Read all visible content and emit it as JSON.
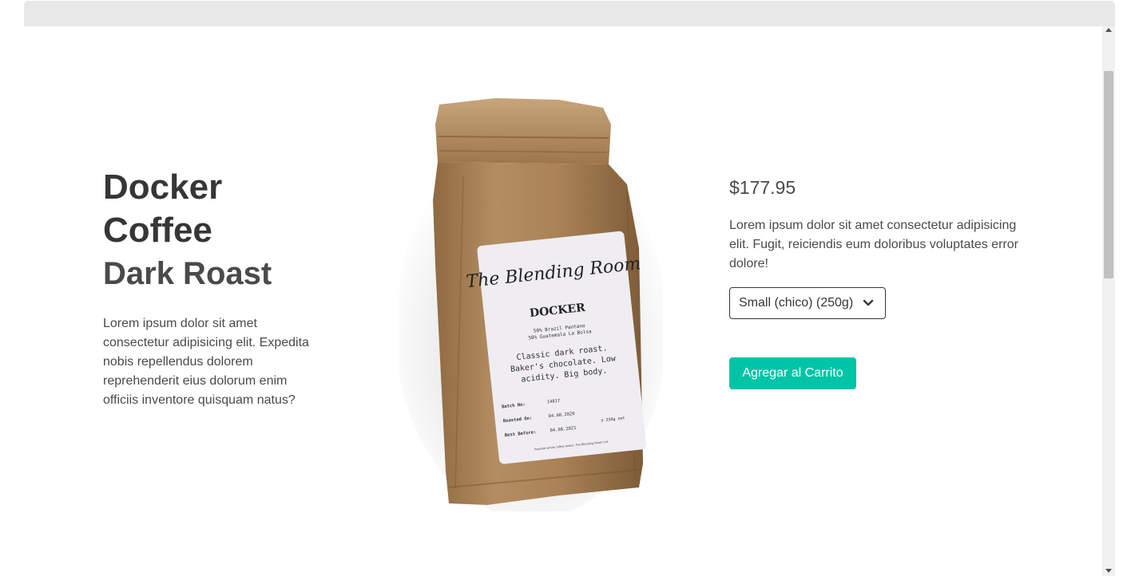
{
  "product": {
    "name": "Docker Coffee",
    "roast": "Dark Roast",
    "description_short": "Lorem ipsum dolor sit amet consectetur adipisicing elit. Expedita nobis repellendus dolorem reprehenderit eius dolorum enim officiis inventore quisquam natus?",
    "price": "$177.95",
    "description_long": "Lorem ipsum dolor sit amet consectetur adipisicing elit. Fugit, reiciendis eum doloribus voluptates error dolore!",
    "size_select": {
      "selected": "Small (chico) (250g)"
    },
    "add_to_cart_label": "Agregar al Carrito"
  },
  "bag_label": {
    "brand_script": "The Blending Room",
    "name": "DOCKER",
    "origin_line_1": "50% Brazil Pantano",
    "origin_line_2": "50% Guatemala La Bolsa",
    "notes_line_1": "Classic dark roast.",
    "notes_line_2": "Baker's chocolate. Low",
    "notes_line_3": "acidity. Big body.",
    "batch_label": "Batch No:",
    "batch_value": "14817",
    "roasted_label": "Roasted On:",
    "roasted_value": "04.08.2020",
    "best_label": "Best Before:",
    "best_value": "04.08.2021",
    "weight": "e 250g net",
    "footer": "Roasted whole coffee beans. The Blending Room Ltd."
  },
  "colors": {
    "accent": "#00c4a7",
    "text_dark": "#363636",
    "kraft": "#b08a5f"
  }
}
